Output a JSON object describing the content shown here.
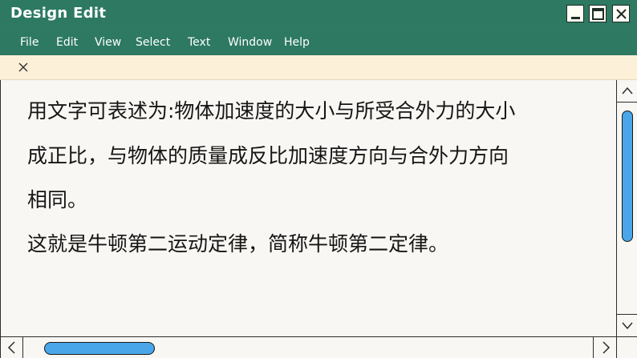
{
  "window": {
    "title": "Design Edit"
  },
  "menu": {
    "items": [
      {
        "label": "File"
      },
      {
        "label": "Edit"
      },
      {
        "label": "View"
      },
      {
        "label": "Select"
      },
      {
        "label": "Text"
      },
      {
        "label": "Window"
      },
      {
        "label": "Help"
      }
    ]
  },
  "document": {
    "lines": [
      "用文字可表述为:物体加速度的大小与所受合外力的大小",
      "成正比，与物体的质量成反比加速度方向与合外力方向",
      "相同。",
      "这就是牛顿第二运动定律，简称牛顿第二定律。"
    ]
  },
  "icons": {
    "minimize": "minimize-icon",
    "maximize": "maximize-icon",
    "close": "close-icon",
    "tab_close": "close-icon",
    "scroll_up": "chevron-up-icon",
    "scroll_down": "chevron-down-icon",
    "scroll_left": "chevron-left-icon",
    "scroll_right": "chevron-right-icon"
  },
  "colors": {
    "titlebar": "#2d7962",
    "tabbar": "#fdf0d8",
    "editor_bg": "#f9f7f3",
    "scroll_thumb": "#4aa6e8",
    "text": "#151515"
  }
}
